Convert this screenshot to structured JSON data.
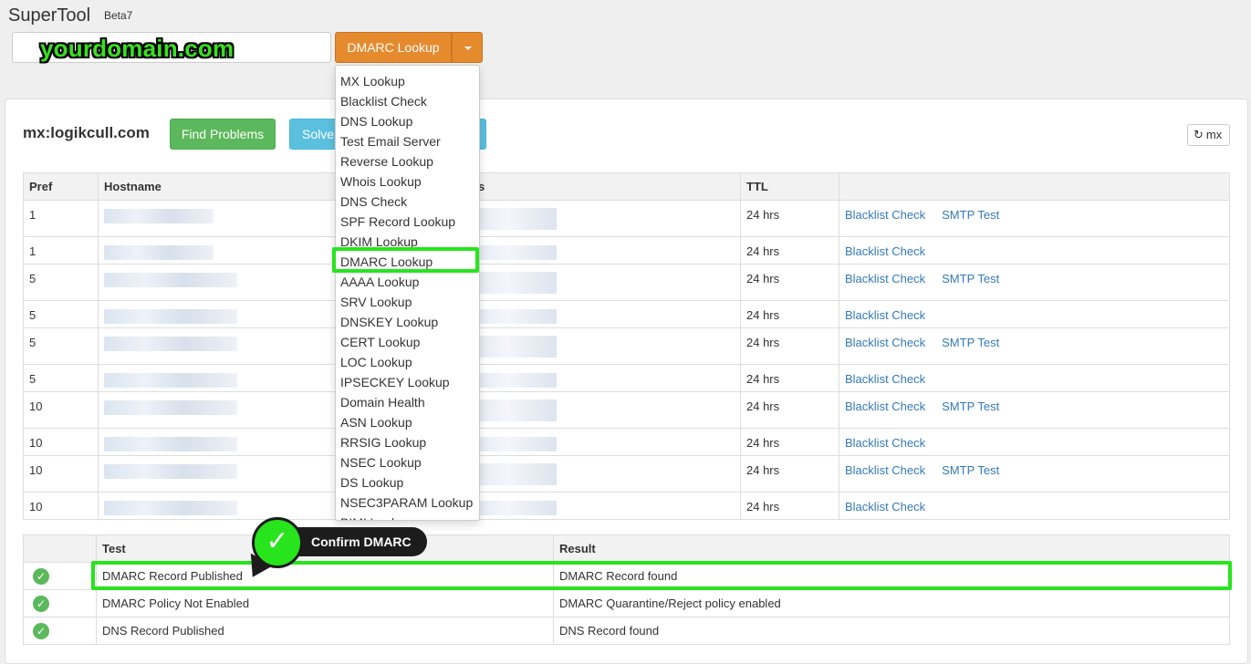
{
  "app": {
    "title": "SuperTool",
    "badge": "Beta7"
  },
  "search": {
    "value": "yourdomain.com",
    "lookup_button": "DMARC Lookup"
  },
  "results": {
    "query": "mx:logikcull.com",
    "find_problems": "Find Problems",
    "solve_label": "Solve",
    "refresh_label": "mx"
  },
  "mx_table": {
    "headers": [
      "Pref",
      "Hostname",
      "s",
      "TTL",
      ""
    ],
    "rows": [
      {
        "pref": "1",
        "ttl": "24 hrs",
        "blacklist": "Blacklist Check",
        "smtp": "SMTP Test"
      },
      {
        "pref": "1",
        "ttl": "24 hrs",
        "blacklist": "Blacklist Check",
        "smtp": ""
      },
      {
        "pref": "5",
        "ttl": "24 hrs",
        "blacklist": "Blacklist Check",
        "smtp": "SMTP Test"
      },
      {
        "pref": "5",
        "ttl": "24 hrs",
        "blacklist": "Blacklist Check",
        "smtp": ""
      },
      {
        "pref": "5",
        "ttl": "24 hrs",
        "blacklist": "Blacklist Check",
        "smtp": "SMTP Test"
      },
      {
        "pref": "5",
        "ttl": "24 hrs",
        "blacklist": "Blacklist Check",
        "smtp": ""
      },
      {
        "pref": "10",
        "ttl": "24 hrs",
        "blacklist": "Blacklist Check",
        "smtp": "SMTP Test"
      },
      {
        "pref": "10",
        "ttl": "24 hrs",
        "blacklist": "Blacklist Check",
        "smtp": ""
      },
      {
        "pref": "10",
        "ttl": "24 hrs",
        "blacklist": "Blacklist Check",
        "smtp": "SMTP Test"
      },
      {
        "pref": "10",
        "ttl": "24 hrs",
        "blacklist": "Blacklist Check",
        "smtp": ""
      }
    ]
  },
  "dropdown": {
    "items": [
      "MX Lookup",
      "Blacklist Check",
      "DNS Lookup",
      "Test Email Server",
      "Reverse Lookup",
      "Whois Lookup",
      "DNS Check",
      "SPF Record Lookup",
      "DKIM Lookup",
      "DMARC Lookup",
      "AAAA Lookup",
      "SRV Lookup",
      "DNSKEY Lookup",
      "CERT Lookup",
      "LOC Lookup",
      "IPSECKEY Lookup",
      "Domain Health",
      "ASN Lookup",
      "RRSIG Lookup",
      "NSEC Lookup",
      "DS Lookup",
      "NSEC3PARAM Lookup",
      "BIMI Lookup"
    ],
    "selected": "DMARC Lookup"
  },
  "test_table": {
    "headers": [
      "",
      "Test",
      "Result"
    ],
    "rows": [
      {
        "test": "DMARC Record Published",
        "result": "DMARC Record found"
      },
      {
        "test": "DMARC Policy Not Enabled",
        "result": "DMARC Quarantine/Reject policy enabled"
      },
      {
        "test": "DNS Record Published",
        "result": "DNS Record found"
      }
    ]
  },
  "callout": {
    "label": "Confirm DMARC"
  },
  "colors": {
    "lookup_orange": "#e68a2e",
    "success_green": "#5cb85c",
    "info_blue": "#5bc0de",
    "highlight_green": "#27e41d",
    "link_blue": "#337ab7"
  }
}
